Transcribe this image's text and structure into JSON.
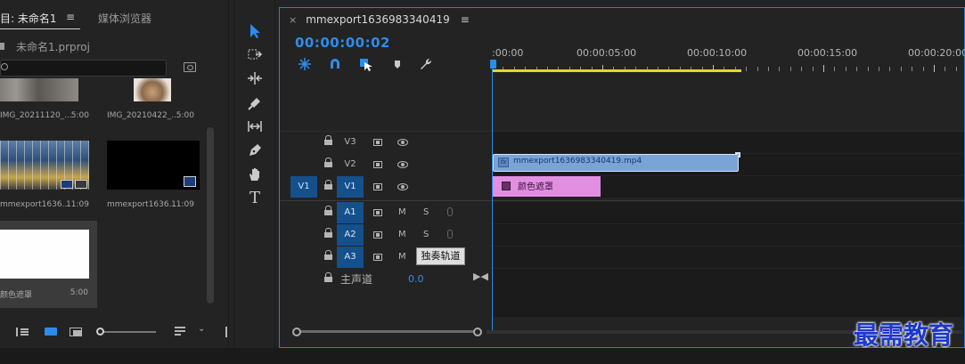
{
  "project_panel": {
    "tab_project": "目: 未命名1",
    "tab_menu": "≡",
    "tab_media": "媒体浏览器",
    "project_file": "未命名1.prproj",
    "search_placeholder": "",
    "clips": [
      {
        "name": "IMG_20211120_...",
        "duration": "5:00"
      },
      {
        "name": "IMG_20210422_...",
        "duration": "5:00"
      },
      {
        "name": "mmexport1636...",
        "duration": "11:09"
      },
      {
        "name": "mmexport1636...",
        "duration": "11:09"
      },
      {
        "name": "颜色遮罩",
        "duration": "5:00"
      }
    ]
  },
  "timeline": {
    "tab_close": "×",
    "sequence_name": "mmexport1636983340419",
    "tab_menu": "≡",
    "timecode": "00:00:00:02",
    "ruler_labels": [
      ":00:00",
      "00:00:05:00",
      "00:00:10:00",
      "00:00:15:00",
      "00:00:20:00"
    ],
    "source_patch": "V1",
    "tracks": {
      "v3": "V3",
      "v2": "V2",
      "v1": "V1",
      "a1": "A1",
      "a2": "A2",
      "a3": "A3"
    },
    "mute_label": "M",
    "solo_label": "S",
    "master_label": "主声道",
    "master_value": "0.0",
    "master_end": "▶◀",
    "clip_video": {
      "name": "mmexport1636983340419.mp4",
      "fx": "fx"
    },
    "clip_matte": {
      "name": "颜色遮罩"
    },
    "tooltip": "独奏轨道"
  },
  "watermark": "最需教育",
  "colors": {
    "accent": "#2d8ceb",
    "video_clip": "#7aa3d6",
    "matte_clip": "#e28fe2",
    "work_area": "#e6d62b",
    "track_on": "#14508c"
  }
}
